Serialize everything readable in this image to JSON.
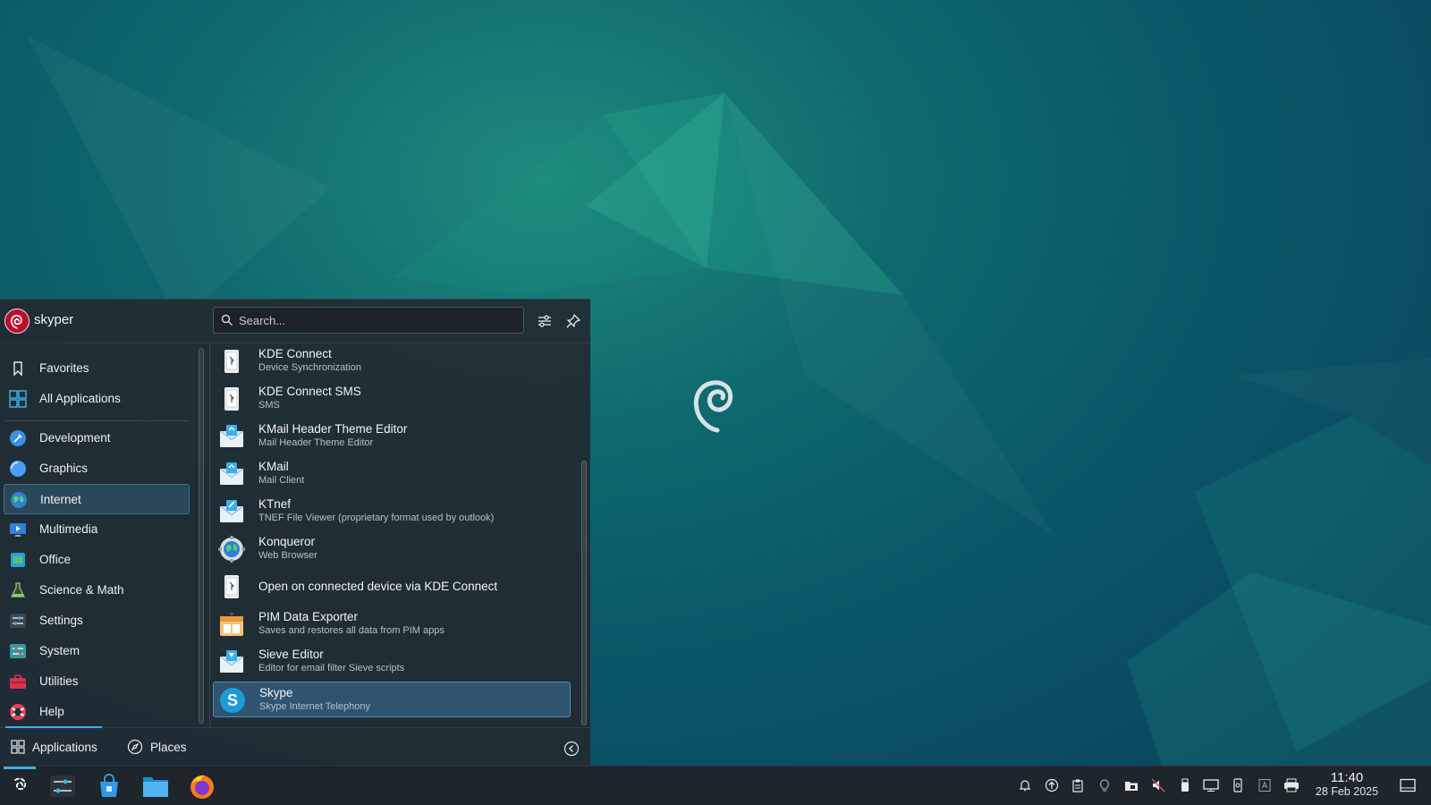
{
  "launcher": {
    "user_name": "skyper",
    "search_placeholder": "Search...",
    "categories": [
      {
        "label": "Favorites",
        "icon": "bookmark-icon"
      },
      {
        "label": "All Applications",
        "icon": "grid-icon"
      },
      {
        "label": "Development",
        "icon": "development-icon"
      },
      {
        "label": "Graphics",
        "icon": "graphics-icon"
      },
      {
        "label": "Internet",
        "icon": "globe-icon",
        "active": true
      },
      {
        "label": "Multimedia",
        "icon": "multimedia-icon"
      },
      {
        "label": "Office",
        "icon": "office-icon"
      },
      {
        "label": "Science & Math",
        "icon": "science-icon"
      },
      {
        "label": "Settings",
        "icon": "settings-icon"
      },
      {
        "label": "System",
        "icon": "system-icon"
      },
      {
        "label": "Utilities",
        "icon": "utilities-icon"
      },
      {
        "label": "Help",
        "icon": "help-icon"
      }
    ],
    "apps": [
      {
        "name": "KDE Connect",
        "desc": "Device Synchronization",
        "icon": "kdeconnect-icon"
      },
      {
        "name": "KDE Connect SMS",
        "desc": "SMS",
        "icon": "kdeconnect-icon"
      },
      {
        "name": "KMail Header Theme Editor",
        "desc": "Mail Header Theme Editor",
        "icon": "kmail-icon"
      },
      {
        "name": "KMail",
        "desc": "Mail Client",
        "icon": "kmail-icon"
      },
      {
        "name": "KTnef",
        "desc": "TNEF File Viewer (proprietary format used by outlook)",
        "icon": "kmail-icon"
      },
      {
        "name": "Konqueror",
        "desc": "Web Browser",
        "icon": "konqueror-icon"
      },
      {
        "name": "Open on connected device via KDE Connect",
        "desc": "",
        "icon": "kdeconnect-icon"
      },
      {
        "name": "PIM Data Exporter",
        "desc": "Saves and restores all data from PIM apps",
        "icon": "pim-exporter-icon"
      },
      {
        "name": "Sieve Editor",
        "desc": "Editor for email filter Sieve scripts",
        "icon": "kmail-icon"
      },
      {
        "name": "Skype",
        "desc": "Skype Internet Telephony",
        "icon": "skype-icon",
        "active": true
      }
    ],
    "footer": {
      "applications_label": "Applications",
      "places_label": "Places"
    }
  },
  "taskbar": {
    "clock_time": "11:40",
    "clock_date": "28 Feb 2025",
    "pinned": [
      "application-launcher-icon",
      "system-settings-icon",
      "discover-store-icon",
      "file-manager-icon",
      "firefox-icon"
    ],
    "tray": [
      "notifications-icon",
      "updates-icon",
      "clipboard-icon",
      "night-light-icon",
      "vault-icon",
      "volume-muted-icon",
      "usb-device-icon",
      "display-icon",
      "kdeconnect-tray-icon",
      "keyboard-layout-icon",
      "printer-icon",
      "show-desktop-icon"
    ]
  },
  "colors": {
    "accent": "#3daee9",
    "panel": "#222a32",
    "wallpaper_teal": "#0e6a6e",
    "debian_red": "#b9102f"
  }
}
